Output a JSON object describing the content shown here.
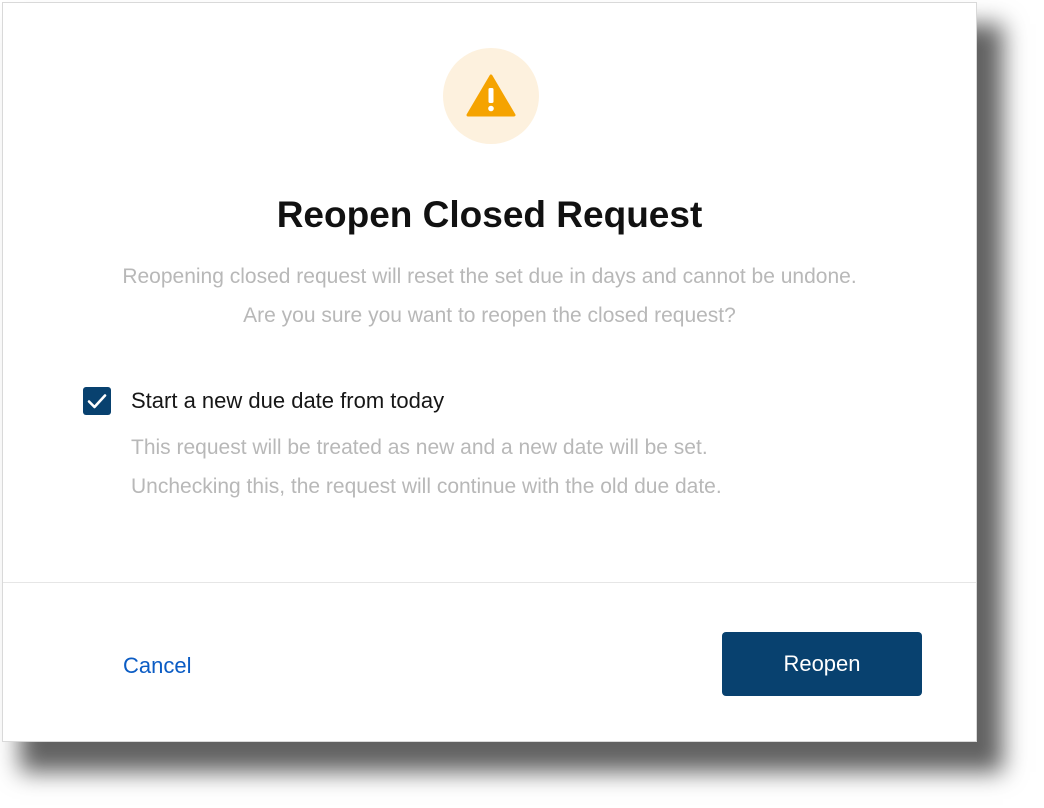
{
  "dialog": {
    "icon": "warning-icon",
    "title": "Reopen Closed Request",
    "description": [
      "Reopening closed request will reset the set due in days and cannot be undone.",
      "Are you sure you want to reopen the closed request?"
    ],
    "option": {
      "checked": true,
      "label": "Start a new due date from today",
      "helper": [
        "This request will be treated as new and a new date will be set.",
        "Unchecking this, the request will continue with the old due date."
      ]
    },
    "actions": {
      "cancel_label": "Cancel",
      "confirm_label": "Reopen"
    }
  },
  "colors": {
    "warning": "#f5a300",
    "warning_bg": "#fdf1de",
    "primary": "#08416f",
    "link": "#0b5cc4",
    "muted_text": "#b8b8b8"
  }
}
